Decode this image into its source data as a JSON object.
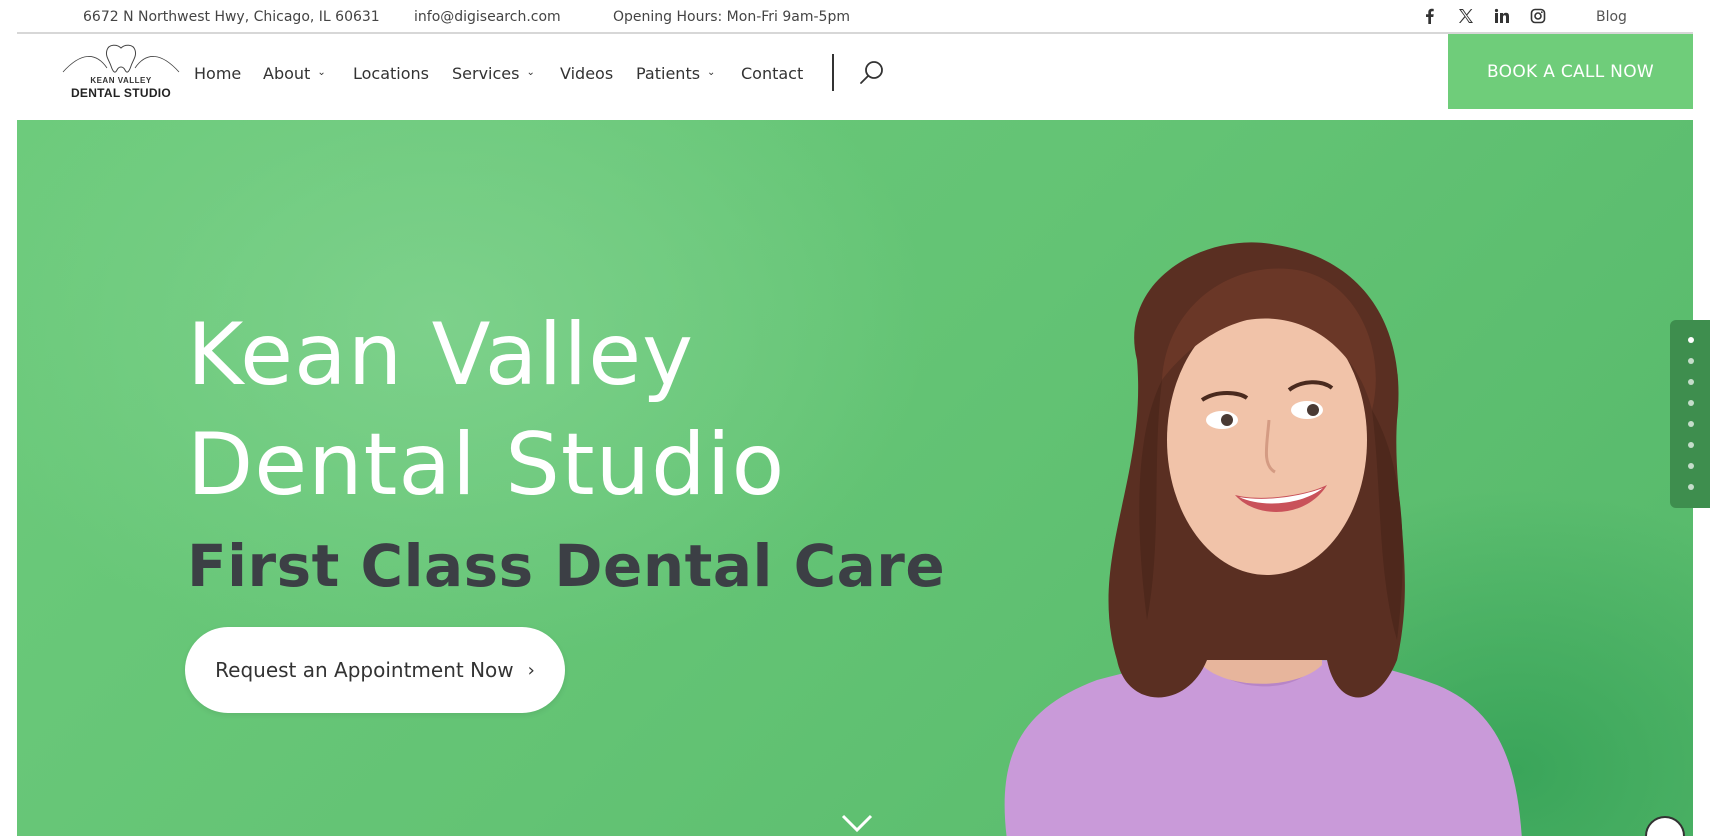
{
  "topbar": {
    "address": "6672 N Northwest Hwy, Chicago, IL 60631",
    "email": "info@digisearch.com",
    "hours": "Opening Hours: Mon-Fri 9am-5pm",
    "social": [
      "facebook-icon",
      "x-icon",
      "linkedin-icon",
      "instagram-icon"
    ],
    "blog": "Blog"
  },
  "logo": {
    "line1": "KEAN VALLEY",
    "line2": "DENTAL STUDIO"
  },
  "nav": {
    "items": [
      {
        "label": "Home",
        "dropdown": false
      },
      {
        "label": "About",
        "dropdown": true
      },
      {
        "label": "Locations",
        "dropdown": false
      },
      {
        "label": "Services",
        "dropdown": true
      },
      {
        "label": "Videos",
        "dropdown": false
      },
      {
        "label": "Patients",
        "dropdown": true
      },
      {
        "label": "Contact",
        "dropdown": false
      }
    ],
    "search_icon": "search-icon",
    "cta": "BOOK A CALL NOW"
  },
  "hero": {
    "title_line1": "Kean Valley",
    "title_line2": "Dental Studio",
    "subtitle": "First Class Dental Care",
    "cta": "Request an Appointment Now",
    "cta_icon": "chevron-right-icon",
    "scroll_icon": "chevron-down-icon"
  },
  "side_nav": {
    "dot_count": 8,
    "active_index": 0
  },
  "colors": {
    "accent_green": "#6fcd7a",
    "hero_green": "#63c374",
    "subtitle_dark": "#3c3f45",
    "shirt_purple": "#c99ad9"
  }
}
